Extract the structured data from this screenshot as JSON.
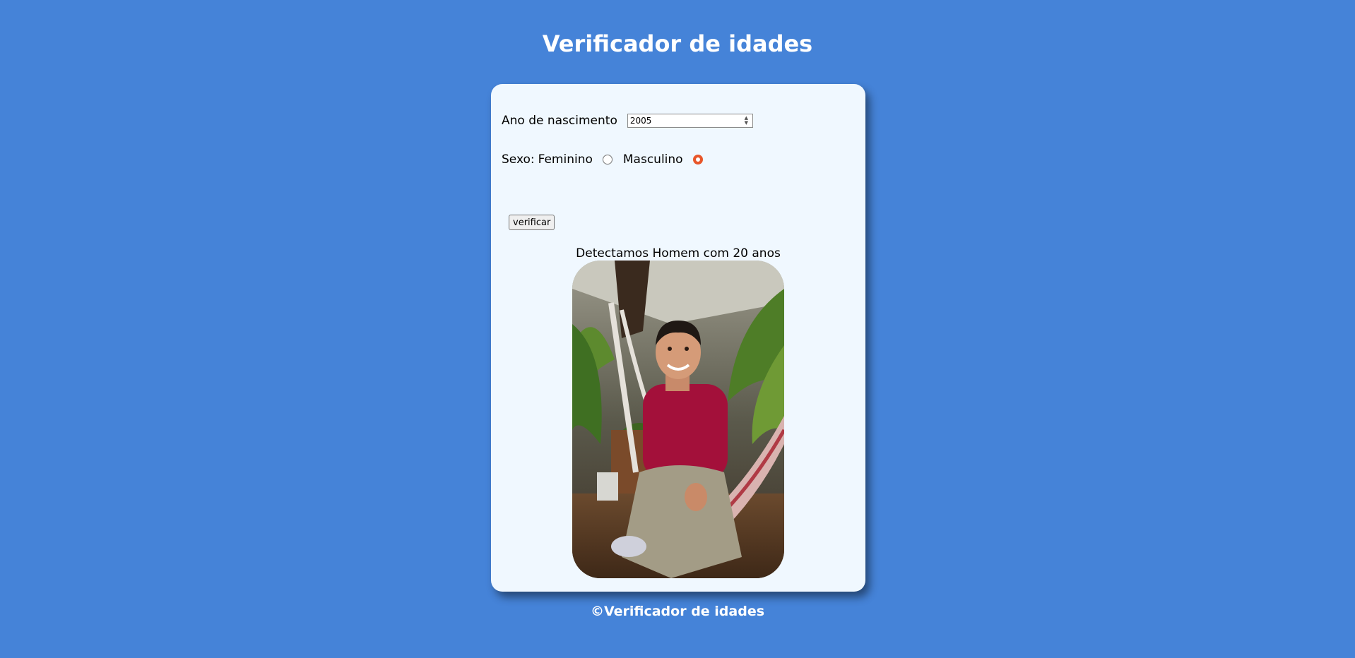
{
  "header": {
    "title": "Verificador de idades"
  },
  "form": {
    "year_label": "Ano de nascimento",
    "year_value": "2005",
    "sex_label": "Sexo:",
    "female_label": "Feminino",
    "male_label": "Masculino",
    "selected_sex": "Masculino",
    "verify_label": "verificar"
  },
  "result": {
    "text": "Detectamos Homem com 20 anos"
  },
  "footer": {
    "text": "©Verificador de idades"
  },
  "colors": {
    "background": "#4583d8",
    "card": "#f0f8ff",
    "radio_accent": "#e8562a"
  }
}
